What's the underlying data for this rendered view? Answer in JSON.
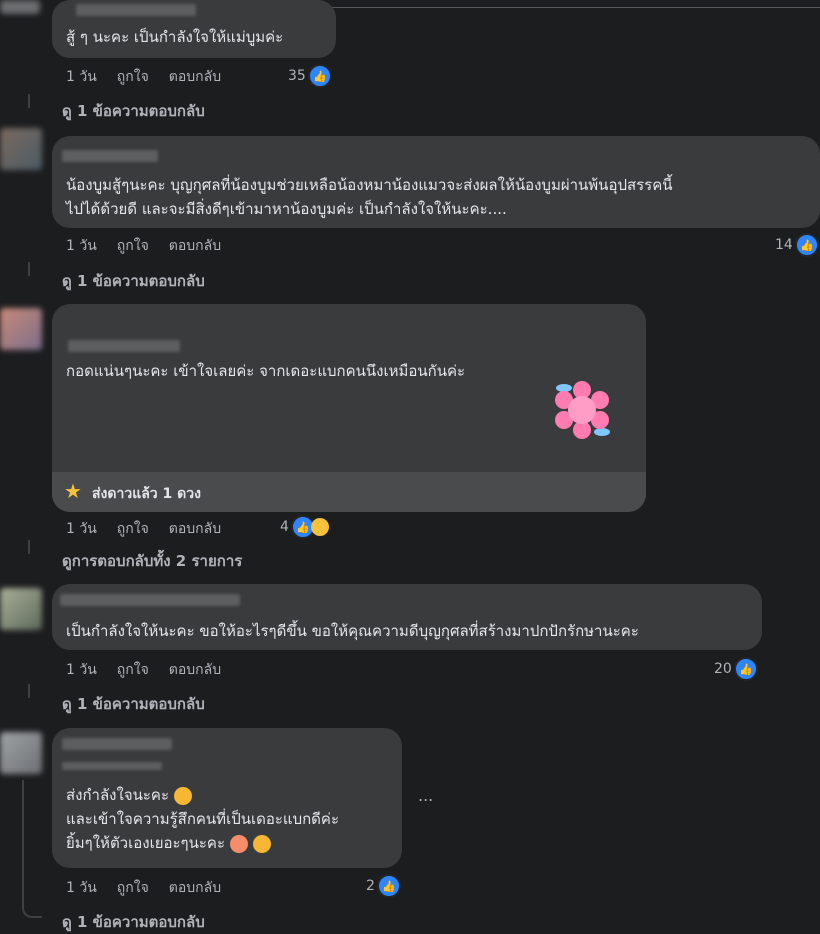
{
  "comments": [
    {
      "text_lines": [
        "สู้ ๆ นะคะ เป็นกำลังใจให้แม่บูมค่ะ"
      ],
      "time": "1 วัน",
      "like_label": "ถูกใจ",
      "reply_label": "ตอบกลับ",
      "reaction_count": "35",
      "replies_link": "ดู 1 ข้อความตอบกลับ"
    },
    {
      "text_lines": [
        "น้องบูมสู้ๆนะคะ บุญกุศลที่น้องบูมช่วยเหลือน้องหมาน้องแมวจะส่งผลให้น้องบูมผ่านพ้นอุปสรรคนี้",
        "ไปได้ด้วยดี และจะมีสิ่งดีๆเข้ามาหาน้องบูมค่ะ เป็นกำลังใจให้นะคะ...."
      ],
      "time": "1 วัน",
      "like_label": "ถูกใจ",
      "reply_label": "ตอบกลับ",
      "reaction_count": "14",
      "replies_link": "ดู 1 ข้อความตอบกลับ"
    },
    {
      "text_lines": [
        "กอดแน่นๆนะคะ เข้าใจเลยค่ะ จากเดอะแบกคนนึงเหมือนกันค่ะ"
      ],
      "star_label": "ส่งดาวแล้ว 1 ดวง",
      "time": "1 วัน",
      "like_label": "ถูกใจ",
      "reply_label": "ตอบกลับ",
      "reaction_count": "4",
      "replies_link": "ดูการตอบกลับทั้ง 2 รายการ"
    },
    {
      "text_lines": [
        "เป็นกำลังใจให้นะคะ ขอให้อะไรๆดีขึ้น ขอให้คุณความดีบุญกุศลที่สร้างมาปกปักรักษานะคะ"
      ],
      "time": "1 วัน",
      "like_label": "ถูกใจ",
      "reply_label": "ตอบกลับ",
      "reaction_count": "20",
      "replies_link": "ดู 1 ข้อความตอบกลับ"
    },
    {
      "text_lines": [
        "ส่งกำลังใจนะคะ",
        "และเข้าใจความรู้สึกคนที่เป็นเดอะแบกดีค่ะ",
        "ยิ้มๆให้ตัวเองเยอะๆนะคะ"
      ],
      "more": "...",
      "time": "1 วัน",
      "like_label": "ถูกใจ",
      "reply_label": "ตอบกลับ",
      "reaction_count": "2",
      "replies_link": "ดู 1 ข้อความตอบกลับ"
    }
  ],
  "colors": {
    "like_blue": "#2d86ff",
    "bubble": "#3a3b3c",
    "background": "#1c1d1f"
  },
  "icons": {
    "like": "thumbs-up-icon",
    "care": "care-emoji-icon",
    "sticker": "pink-flower-sticker",
    "star": "star-icon"
  }
}
